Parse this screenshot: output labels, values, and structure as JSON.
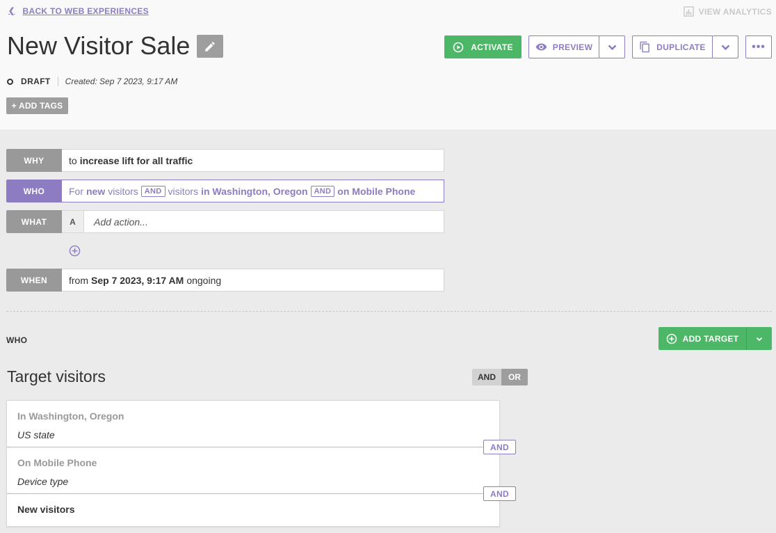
{
  "header": {
    "back_label": "BACK TO WEB EXPERIENCES",
    "view_analytics_label": "VIEW ANALYTICS",
    "title": "New Visitor Sale",
    "activate_label": "ACTIVATE",
    "preview_label": "PREVIEW",
    "duplicate_label": "DUPLICATE",
    "more_label": "•••",
    "status": "DRAFT",
    "created": "Created: Sep 7 2023, 9:17 AM",
    "add_tags_label": "+ ADD TAGS"
  },
  "summary": {
    "why": {
      "label": "WHY",
      "prefix": "to",
      "value": "increase lift for all traffic"
    },
    "who": {
      "label": "WHO",
      "p1": "For",
      "v1": "new",
      "p2": "visitors",
      "and1": "AND",
      "p3": "visitors",
      "v2": "in Washington, Oregon",
      "and2": "AND",
      "v3": "on Mobile Phone"
    },
    "what": {
      "label": "WHAT",
      "tag": "A",
      "placeholder": "Add action..."
    },
    "when": {
      "label": "WHEN",
      "prefix": "from",
      "value": "Sep 7 2023, 9:17 AM",
      "suffix": "ongoing"
    }
  },
  "who_section": {
    "label": "WHO",
    "add_target_label": "ADD TARGET",
    "title": "Target visitors",
    "and_label": "AND",
    "or_label": "OR",
    "targets": [
      {
        "title": "In Washington, Oregon",
        "subtitle": "US state"
      },
      {
        "title": "On Mobile Phone",
        "subtitle": "Device type"
      },
      {
        "title": "New visitors"
      }
    ],
    "connector_label": "AND"
  },
  "colors": {
    "accent": "#8e7cc3",
    "success": "#4cb867",
    "neutral": "#999999"
  }
}
